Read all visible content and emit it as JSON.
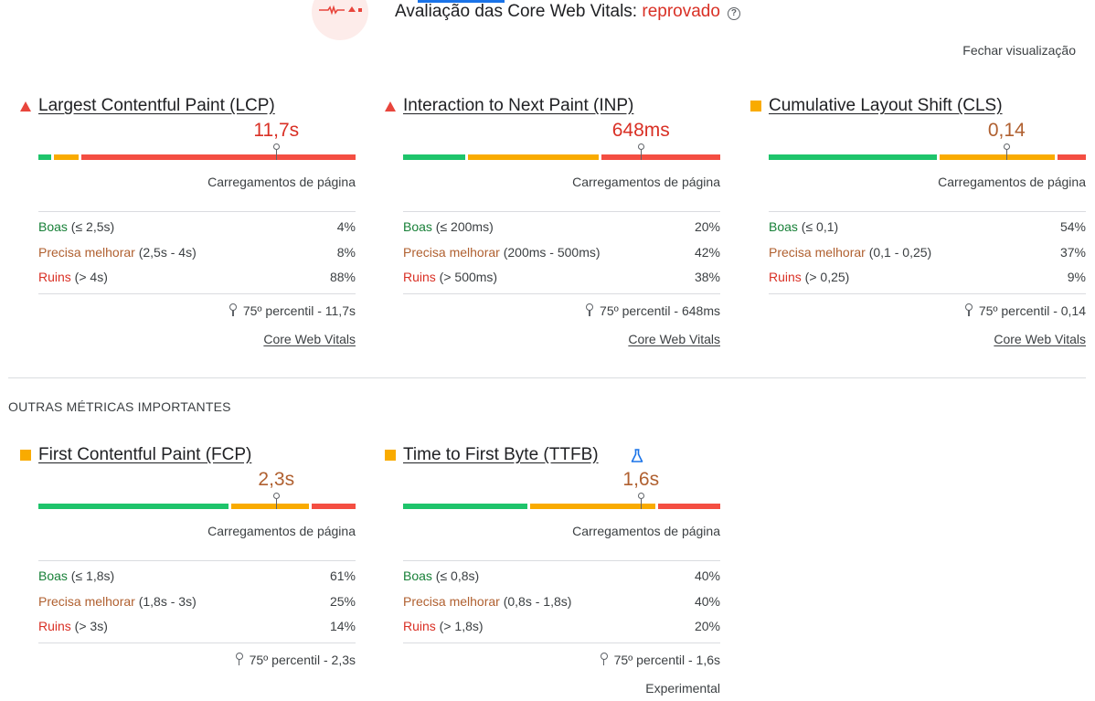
{
  "header": {
    "title_prefix": "Avaliação das Core Web Vitals: ",
    "title_status": "reprovado",
    "help_icon": "help-circle-icon",
    "close_label": "Fechar visualização",
    "status_icon": "failing-vitals-icon",
    "colors": {
      "fail": "#d93025",
      "circle_bg": "#fdecea"
    }
  },
  "colors": {
    "good": "#1ec46b",
    "ni": "#f9ab00",
    "poor": "#f44e42"
  },
  "section_label": "OUTRAS MÉTRICAS IMPORTANTES",
  "cards": {
    "lcp": {
      "title": "Largest Contentful Paint (LCP)",
      "status": "poor",
      "value": "11,7s",
      "value_color": "#d93025",
      "dist": [
        4,
        8,
        88
      ],
      "marker_fraction": 0.75,
      "loads_label": "Carregamentos de página",
      "rows": [
        {
          "name": "Boas",
          "range": " (≤ 2,5s)",
          "pct": "4%"
        },
        {
          "name": "Precisa melhorar",
          "range": " (2,5s - 4s)",
          "pct": "8%"
        },
        {
          "name": "Ruins",
          "range": " (> 4s)",
          "pct": "88%"
        }
      ],
      "percentile": "75º percentil - 11,7s",
      "footer": "Core Web Vitals"
    },
    "inp": {
      "title": "Interaction to Next Paint (INP)",
      "status": "poor",
      "value": "648ms",
      "value_color": "#d93025",
      "dist": [
        20,
        42,
        38
      ],
      "marker_fraction": 0.75,
      "loads_label": "Carregamentos de página",
      "rows": [
        {
          "name": "Boas",
          "range": " (≤ 200ms)",
          "pct": "20%"
        },
        {
          "name": "Precisa melhorar",
          "range": " (200ms - 500ms)",
          "pct": "42%"
        },
        {
          "name": "Ruins",
          "range": " (> 500ms)",
          "pct": "38%"
        }
      ],
      "percentile": "75º percentil - 648ms",
      "footer": "Core Web Vitals"
    },
    "cls": {
      "title": "Cumulative Layout Shift (CLS)",
      "status": "ni",
      "value": "0,14",
      "value_color": "#b06030",
      "dist": [
        54,
        37,
        9
      ],
      "marker_fraction": 0.75,
      "loads_label": "Carregamentos de página",
      "rows": [
        {
          "name": "Boas",
          "range": " (≤ 0,1)",
          "pct": "54%"
        },
        {
          "name": "Precisa melhorar",
          "range": " (0,1 - 0,25)",
          "pct": "37%"
        },
        {
          "name": "Ruins",
          "range": " (> 0,25)",
          "pct": "9%"
        }
      ],
      "percentile": "75º percentil - 0,14",
      "footer": "Core Web Vitals"
    },
    "fcp": {
      "title": "First Contentful Paint (FCP)",
      "status": "ni",
      "value": "2,3s",
      "value_color": "#b06030",
      "dist": [
        61,
        25,
        14
      ],
      "marker_fraction": 0.75,
      "loads_label": "Carregamentos de página",
      "rows": [
        {
          "name": "Boas",
          "range": " (≤ 1,8s)",
          "pct": "61%"
        },
        {
          "name": "Precisa melhorar",
          "range": " (1,8s - 3s)",
          "pct": "25%"
        },
        {
          "name": "Ruins",
          "range": " (> 3s)",
          "pct": "14%"
        }
      ],
      "percentile": "75º percentil - 2,3s"
    },
    "ttfb": {
      "title": "Time to First Byte (TTFB)",
      "status": "ni",
      "value": "1,6s",
      "value_color": "#b06030",
      "dist": [
        40,
        40,
        20
      ],
      "marker_fraction": 0.75,
      "loads_label": "Carregamentos de página",
      "rows": [
        {
          "name": "Boas",
          "range": " (≤ 0,8s)",
          "pct": "40%"
        },
        {
          "name": "Precisa melhorar",
          "range": " (0,8s - 1,8s)",
          "pct": "40%"
        },
        {
          "name": "Ruins",
          "range": " (> 1,8s)",
          "pct": "20%"
        }
      ],
      "percentile": "75º percentil - 1,6s",
      "footer": "Experimental",
      "experimental_icon": "flask-icon"
    }
  }
}
